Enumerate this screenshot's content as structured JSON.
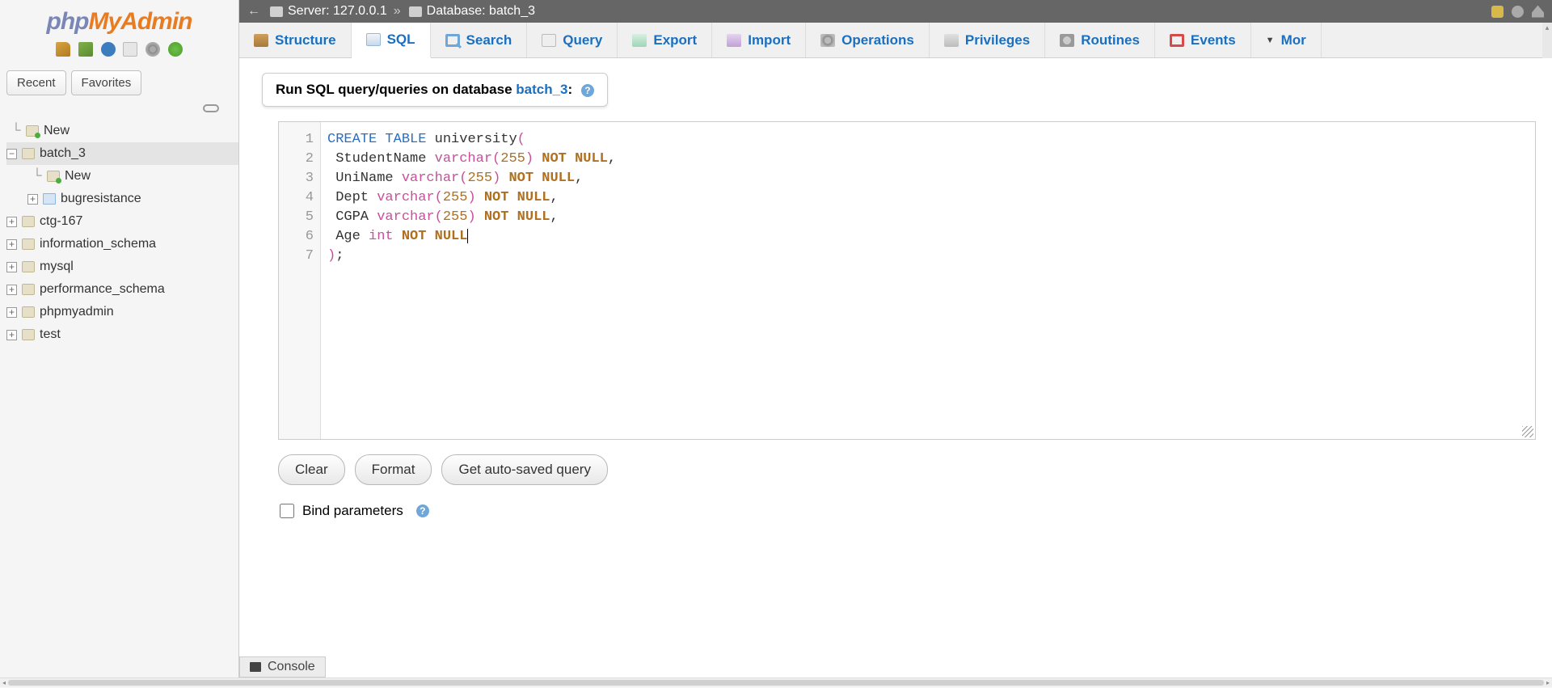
{
  "logo": {
    "p1": "php",
    "p2": "My",
    "p3": "Admin"
  },
  "sidebar": {
    "recent": "Recent",
    "favorites": "Favorites",
    "nodes": [
      {
        "label": "New",
        "type": "new",
        "indent": 0,
        "expander": ""
      },
      {
        "label": "batch_3",
        "type": "db",
        "indent": 0,
        "expander": "−",
        "selected": true
      },
      {
        "label": "New",
        "type": "new",
        "indent": 1,
        "expander": ""
      },
      {
        "label": "bugresistance",
        "type": "table",
        "indent": 1,
        "expander": "+"
      },
      {
        "label": "ctg-167",
        "type": "db",
        "indent": 0,
        "expander": "+"
      },
      {
        "label": "information_schema",
        "type": "db",
        "indent": 0,
        "expander": "+"
      },
      {
        "label": "mysql",
        "type": "db",
        "indent": 0,
        "expander": "+"
      },
      {
        "label": "performance_schema",
        "type": "db",
        "indent": 0,
        "expander": "+"
      },
      {
        "label": "phpmyadmin",
        "type": "db",
        "indent": 0,
        "expander": "+"
      },
      {
        "label": "test",
        "type": "db",
        "indent": 0,
        "expander": "+"
      }
    ]
  },
  "breadcrumb": {
    "server_label": "Server: ",
    "server_value": "127.0.0.1",
    "database_label": "Database: ",
    "database_value": "batch_3"
  },
  "tabs": {
    "structure": "Structure",
    "sql": "SQL",
    "search": "Search",
    "query": "Query",
    "export": "Export",
    "import": "Import",
    "operations": "Operations",
    "privileges": "Privileges",
    "routines": "Routines",
    "events": "Events",
    "more": "Mor"
  },
  "sql_panel": {
    "prefix": "Run SQL query/queries on database ",
    "dbname": "batch_3",
    "suffix": ":",
    "code_lines": [
      [
        {
          "t": "CREATE",
          "c": "kw"
        },
        {
          "t": " TABLE",
          "c": "kw"
        },
        {
          "t": " university"
        },
        {
          "t": "(",
          "c": "br"
        }
      ],
      [
        {
          "t": " StudentName "
        },
        {
          "t": "varchar",
          "c": "ty"
        },
        {
          "t": "(",
          "c": "br"
        },
        {
          "t": "255",
          "c": "num"
        },
        {
          "t": ")",
          "c": "br"
        },
        {
          "t": " NOT",
          "c": "constr"
        },
        {
          "t": " NULL",
          "c": "constr"
        },
        {
          "t": ","
        }
      ],
      [
        {
          "t": " UniName "
        },
        {
          "t": "varchar",
          "c": "ty"
        },
        {
          "t": "(",
          "c": "br"
        },
        {
          "t": "255",
          "c": "num"
        },
        {
          "t": ")",
          "c": "br"
        },
        {
          "t": " NOT",
          "c": "constr"
        },
        {
          "t": " NULL",
          "c": "constr"
        },
        {
          "t": ","
        }
      ],
      [
        {
          "t": " Dept "
        },
        {
          "t": "varchar",
          "c": "ty"
        },
        {
          "t": "(",
          "c": "br"
        },
        {
          "t": "255",
          "c": "num"
        },
        {
          "t": ")",
          "c": "br"
        },
        {
          "t": " NOT",
          "c": "constr"
        },
        {
          "t": " NULL",
          "c": "constr"
        },
        {
          "t": ","
        }
      ],
      [
        {
          "t": " CGPA "
        },
        {
          "t": "varchar",
          "c": "ty"
        },
        {
          "t": "(",
          "c": "br"
        },
        {
          "t": "255",
          "c": "num"
        },
        {
          "t": ")",
          "c": "br"
        },
        {
          "t": " NOT",
          "c": "constr"
        },
        {
          "t": " NULL",
          "c": "constr"
        },
        {
          "t": ","
        }
      ],
      [
        {
          "t": " Age "
        },
        {
          "t": "int",
          "c": "ty"
        },
        {
          "t": " NOT",
          "c": "constr"
        },
        {
          "t": " NULL",
          "c": "constr"
        }
      ],
      [
        {
          "t": ")",
          "c": "br"
        },
        {
          "t": ";"
        }
      ]
    ],
    "buttons": {
      "clear": "Clear",
      "format": "Format",
      "autosaved": "Get auto-saved query"
    },
    "bind_label": "Bind parameters"
  },
  "console_label": "Console"
}
